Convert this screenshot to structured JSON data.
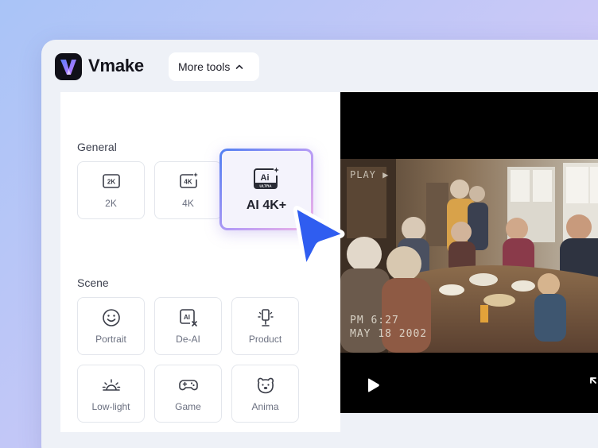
{
  "app": {
    "name": "Vmake"
  },
  "toolbar": {
    "more_tools_label": "More tools"
  },
  "panel": {
    "general_label": "General",
    "scene_label": "Scene",
    "general_options": [
      {
        "label": "2K",
        "icon": "2k-badge-icon"
      },
      {
        "label": "4K",
        "icon": "4k-sparkle-icon"
      }
    ],
    "featured_option": {
      "label": "AI 4K+",
      "icon": "ai-ultra-icon",
      "icon_text": "Ai",
      "icon_subtext": "ULTRA"
    },
    "scene_options": [
      {
        "label": "Portrait",
        "icon": "smiley-face-icon"
      },
      {
        "label": "De-AI",
        "icon": "de-ai-icon"
      },
      {
        "label": "Product",
        "icon": "product-lamp-icon"
      },
      {
        "label": "Low-light",
        "icon": "sunrise-icon"
      },
      {
        "label": "Game",
        "icon": "gamepad-icon"
      },
      {
        "label": "Anima",
        "icon": "bear-face-icon"
      }
    ]
  },
  "video": {
    "osd_play": "PLAY ▶",
    "osd_time": "PM 6:27",
    "osd_date": "MAY 18 2002"
  },
  "colors": {
    "accent_blue": "#2f5df0",
    "background_gradient": [
      "#a9c4f7",
      "#e7cdfa"
    ],
    "card_border": "#e3e6ec"
  }
}
